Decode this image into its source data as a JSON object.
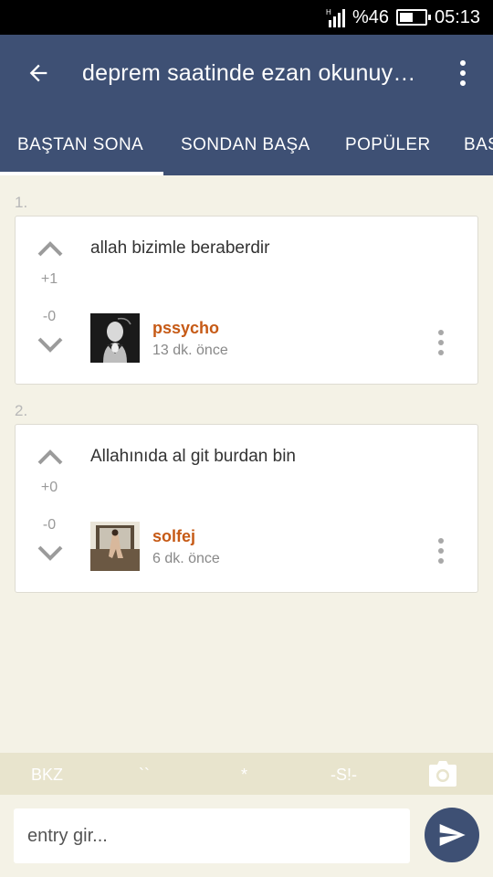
{
  "status_bar": {
    "network": "H",
    "battery_percent": "%46",
    "time": "05:13"
  },
  "header": {
    "title": "deprem saatinde ezan okunuy…"
  },
  "tabs": [
    {
      "label": "BAŞTAN SONA",
      "active": true
    },
    {
      "label": "SONDAN BAŞA",
      "active": false
    },
    {
      "label": "POPÜLER",
      "active": false
    },
    {
      "label": "BAS",
      "active": false
    }
  ],
  "entries": [
    {
      "number": "1.",
      "text": "allah bizimle beraberdir",
      "score_up": "+1",
      "score_down": "-0",
      "author": "pssycho",
      "time": "13 dk. önce"
    },
    {
      "number": "2.",
      "text": "Allahınıda al git burdan bin",
      "score_up": "+0",
      "score_down": "-0",
      "author": "solfej",
      "time": "6 dk. önce"
    }
  ],
  "format_toolbar": {
    "bkz": "BKZ",
    "backticks": "``",
    "star": "*",
    "spoiler": "-S!-"
  },
  "composer": {
    "placeholder": "entry gir..."
  },
  "colors": {
    "primary": "#3e5074",
    "accent_author": "#c65a16",
    "background": "#f4f2e6"
  }
}
